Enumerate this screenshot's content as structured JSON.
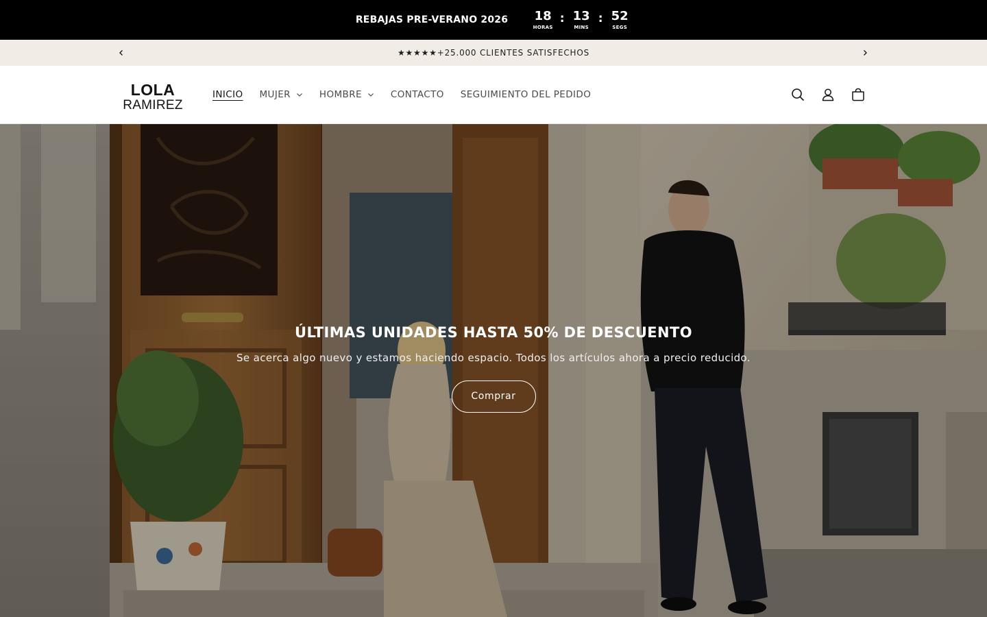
{
  "countdown": {
    "title": "REBAJAS PRE-VERANO 2026",
    "hours": "18",
    "hours_label": "HORAS",
    "minutes": "13",
    "minutes_label": "MINS",
    "seconds": "52",
    "seconds_label": "SEGS",
    "separator": ":"
  },
  "announcement": {
    "text": "★★★★★+25.000 CLIENTES SATISFECHOS",
    "prev_icon": "chevron-left-icon",
    "next_icon": "chevron-right-icon"
  },
  "header": {
    "logo_top": "LOLA",
    "logo_bottom": "RAMIREZ",
    "nav": [
      {
        "label": "INICIO",
        "active": true
      },
      {
        "label": "MUJER",
        "dropdown": true
      },
      {
        "label": "HOMBRE",
        "dropdown": true
      },
      {
        "label": "CONTACTO"
      },
      {
        "label": "SEGUIMIENTO DEL PEDIDO"
      }
    ],
    "icons": [
      "search-icon",
      "account-icon",
      "cart-icon"
    ]
  },
  "hero": {
    "title": "ÚLTIMAS UNIDADES HASTA 50% DE DESCUENTO",
    "subtitle": "Se acerca algo nuevo y estamos haciendo espacio. Todos los artículos ahora a precio reducido.",
    "button_label": "Comprar"
  },
  "colors": {
    "countdown_bg": "#000000",
    "announcement_bg": "#f1ede6",
    "text": "#121212"
  }
}
